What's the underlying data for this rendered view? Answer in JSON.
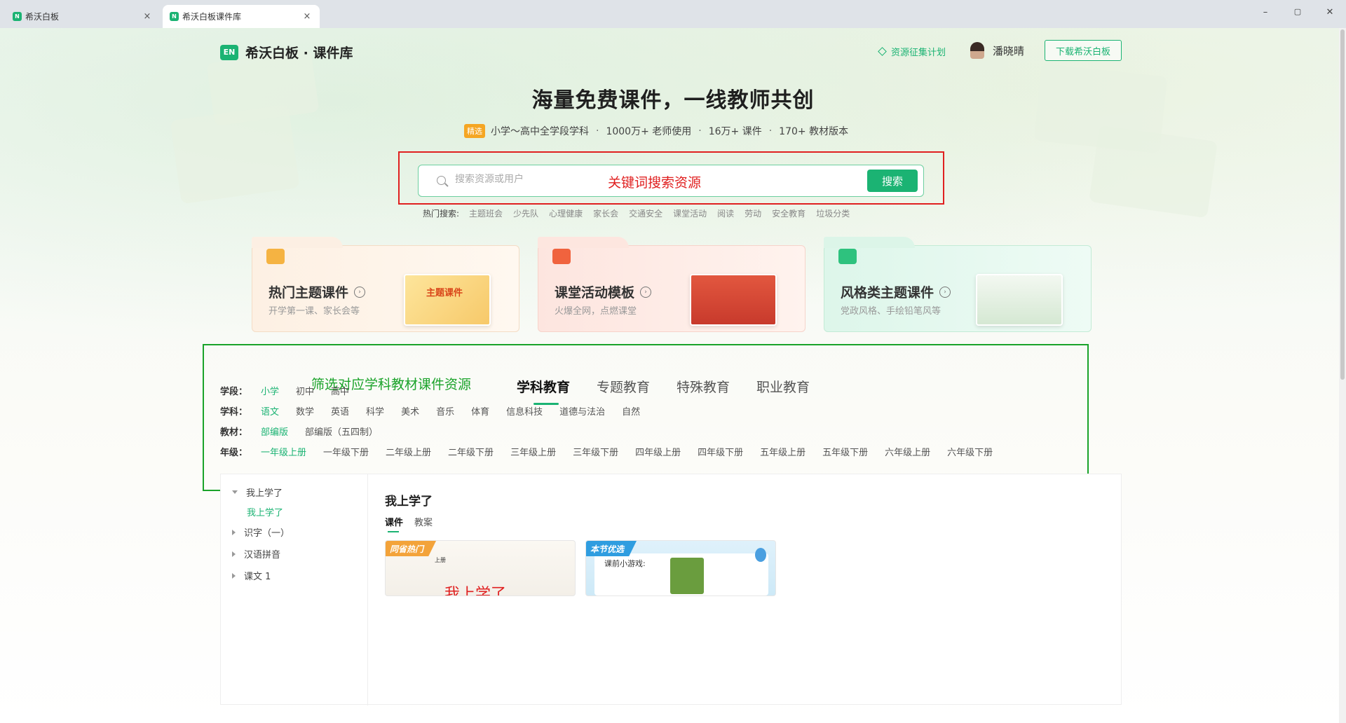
{
  "browser": {
    "tabs": [
      {
        "label": "希沃白板",
        "close": "×"
      },
      {
        "label": "希沃白板课件库",
        "close": "×"
      }
    ],
    "favicon_text": "N",
    "window_controls": [
      "–",
      "▢",
      "✕"
    ]
  },
  "header": {
    "logo_mark": "EN",
    "logo_text": "希沃白板 · 课件库",
    "resource_plan_link": "资源征集计划",
    "user_name": "潘晓晴",
    "download_button": "下载希沃白板"
  },
  "hero": {
    "title": "海量免费课件，一线教师共创",
    "badge": "精选",
    "stats": [
      "小学～高中全学段学科",
      "1000万+ 老师使用",
      "16万+ 课件",
      "170+ 教材版本"
    ],
    "stat_separator": "·"
  },
  "search": {
    "placeholder": "搜索资源或用户",
    "annotation": "关键词搜索资源",
    "button": "搜索",
    "hot_label": "热门搜索:",
    "hot_items": [
      "主题班会",
      "少先队",
      "心理健康",
      "家长会",
      "交通安全",
      "课堂活动",
      "阅读",
      "劳动",
      "安全教育",
      "垃圾分类"
    ]
  },
  "categories": [
    {
      "title": "热门主题课件",
      "desc": "开学第一课、家长会等",
      "icon": "graduation-cap-icon",
      "thumb_text": "主题课件"
    },
    {
      "title": "课堂活动模板",
      "desc": "火爆全网，点燃课堂",
      "icon": "activity-icon"
    },
    {
      "title": "风格类主题课件",
      "desc": "党政风格、手绘铅笔风等",
      "icon": "book-icon"
    }
  ],
  "filter": {
    "annotation": "筛选对应学科教材课件资源",
    "tabs": [
      {
        "label": "学科教育",
        "active": true
      },
      {
        "label": "专题教育",
        "active": false
      },
      {
        "label": "特殊教育",
        "active": false
      },
      {
        "label": "职业教育",
        "active": false
      }
    ],
    "rows": [
      {
        "label": "学段：",
        "options": [
          "小学",
          "初中",
          "高中"
        ],
        "selected": 0
      },
      {
        "label": "学科：",
        "options": [
          "语文",
          "数学",
          "英语",
          "科学",
          "美术",
          "音乐",
          "体育",
          "信息科技",
          "道德与法治",
          "自然"
        ],
        "selected": 0
      },
      {
        "label": "教材：",
        "options": [
          "部编版",
          "部编版（五四制）"
        ],
        "selected": 0
      },
      {
        "label": "年级：",
        "options": [
          "一年级上册",
          "一年级下册",
          "二年级上册",
          "二年级下册",
          "三年级上册",
          "三年级下册",
          "四年级上册",
          "四年级下册",
          "五年级上册",
          "五年级下册",
          "六年级上册",
          "六年级下册"
        ],
        "selected": 0
      }
    ]
  },
  "content": {
    "tree": [
      {
        "label": "我上学了",
        "expanded": true
      },
      {
        "label": "我上学了",
        "child": true
      },
      {
        "label": "识字（一）",
        "expanded": false
      },
      {
        "label": "汉语拼音",
        "expanded": false
      },
      {
        "label": "课文 1",
        "expanded": false
      }
    ],
    "title": "我上学了",
    "subtabs": [
      {
        "label": "课件",
        "active": true
      },
      {
        "label": "教案",
        "active": false
      }
    ],
    "cards": [
      {
        "badge": "同省热门",
        "mini": "上册",
        "title": "我上学了"
      },
      {
        "badge": "本节优选",
        "mini": "课前小游戏:"
      }
    ]
  },
  "colors": {
    "brand_green": "#1bb373",
    "annotation_red": "#e02020",
    "annotation_green": "#1aa32a",
    "badge_orange": "#f5a623"
  }
}
